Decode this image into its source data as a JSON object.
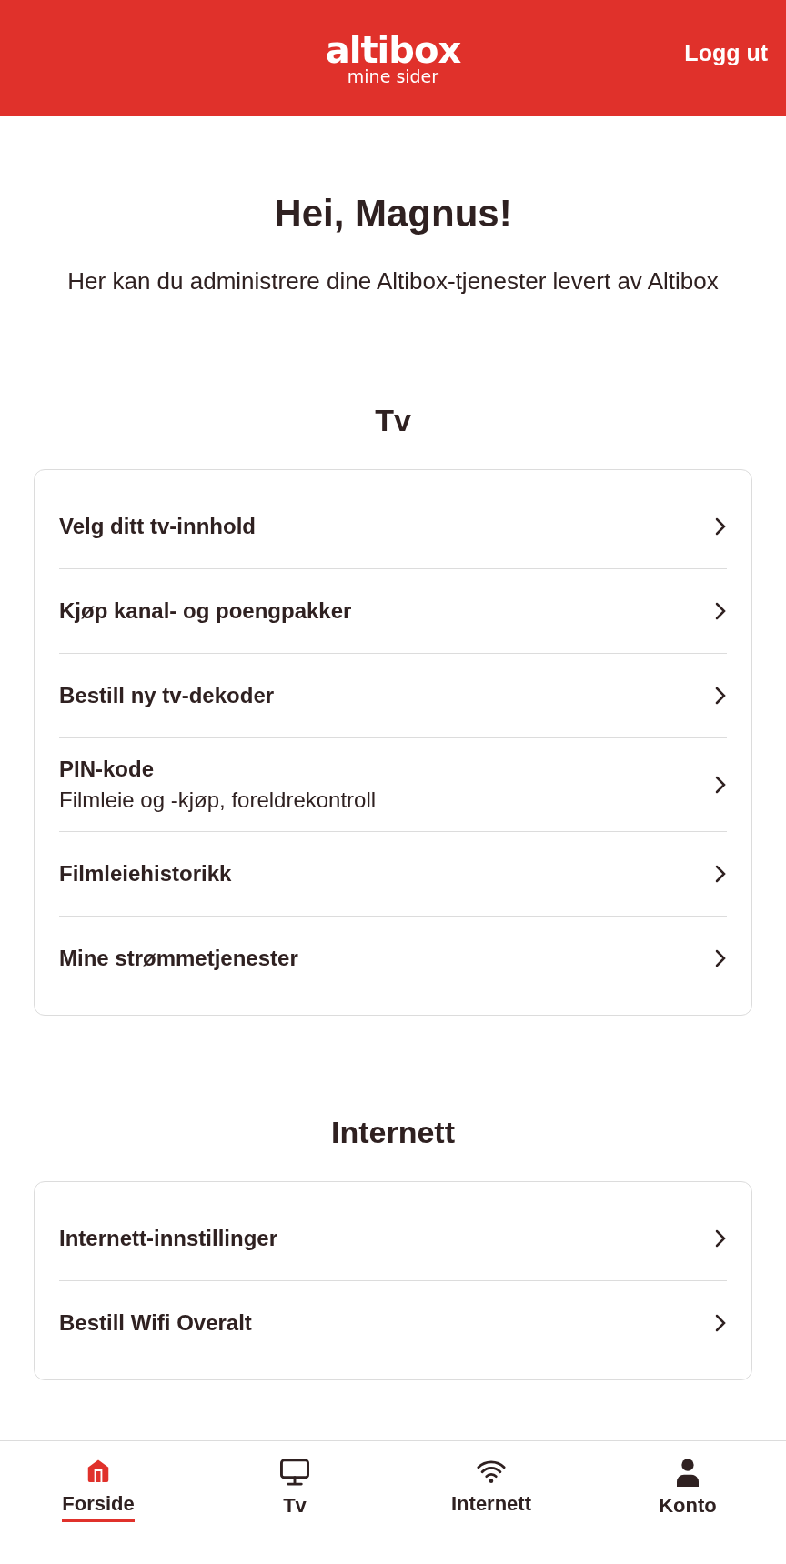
{
  "header": {
    "logo": "altibox",
    "logo_subtitle": "mine sider",
    "logout": "Logg ut"
  },
  "greeting": {
    "title": "Hei, Magnus!",
    "text": "Her kan du administrere dine Altibox-tjenester levert av Altibox"
  },
  "sections": [
    {
      "title": "Tv",
      "items": [
        {
          "label": "Velg ditt tv-innhold"
        },
        {
          "label": "Kjøp kanal- og poengpakker"
        },
        {
          "label": "Bestill ny tv-dekoder"
        },
        {
          "label": "PIN-kode",
          "description": "Filmleie og -kjøp, foreldrekontroll"
        },
        {
          "label": "Filmleiehistorikk"
        },
        {
          "label": "Mine strømmetjenester"
        }
      ]
    },
    {
      "title": "Internett",
      "items": [
        {
          "label": "Internett-innstillinger"
        },
        {
          "label": "Bestill Wifi Overalt"
        }
      ]
    }
  ],
  "bottom_nav": [
    {
      "kind": "home",
      "label": "Forside",
      "selected": true
    },
    {
      "kind": "tv",
      "label": "Tv",
      "selected": false
    },
    {
      "kind": "wifi",
      "label": "Internett",
      "selected": false
    },
    {
      "kind": "person",
      "label": "Konto",
      "selected": false
    }
  ]
}
